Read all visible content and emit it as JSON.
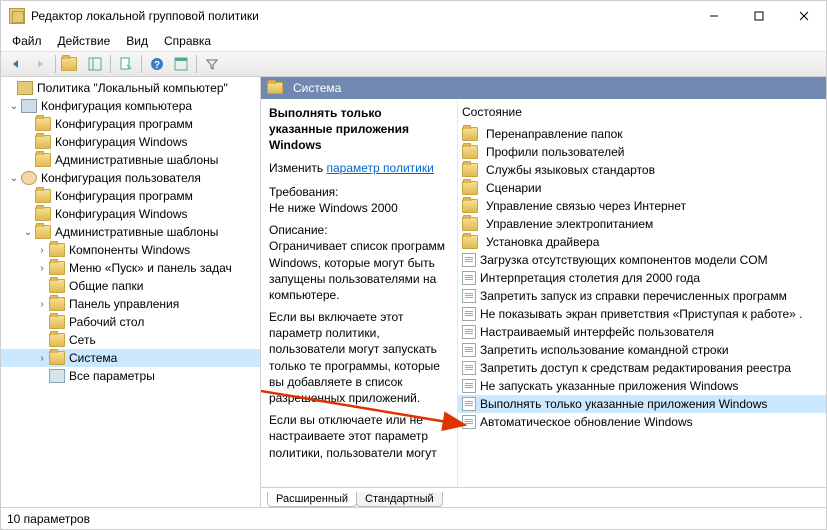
{
  "window": {
    "title": "Редактор локальной групповой политики"
  },
  "menubar": [
    "Файл",
    "Действие",
    "Вид",
    "Справка"
  ],
  "tree": {
    "root": "Политика \"Локальный компьютер\"",
    "computer": "Конфигурация компьютера",
    "computer_children": [
      "Конфигурация программ",
      "Конфигурация Windows",
      "Административные шаблоны"
    ],
    "user": "Конфигурация пользователя",
    "user_children": [
      "Конфигурация программ",
      "Конфигурация Windows"
    ],
    "admin_templates": "Административные шаблоны",
    "at_children": [
      "Компоненты Windows",
      "Меню «Пуск» и панель задач",
      "Общие папки",
      "Панель управления",
      "Рабочий стол",
      "Сеть",
      "Система"
    ],
    "all_params": "Все параметры"
  },
  "header": {
    "title": "Система"
  },
  "desc": {
    "title": "Выполнять только указанные приложения Windows",
    "edit_label": "Изменить",
    "link": "параметр политики",
    "req_label": "Требования:",
    "req_text": "Не ниже Windows 2000",
    "desc_label": "Описание:",
    "p1": "Ограничивает список программ Windows, которые могут быть запущены пользователями на компьютере.",
    "p2": "Если вы включаете этот параметр политики, пользователи могут запускать только те программы, которые вы добавляете в список разрешенных приложений.",
    "p3": "Если вы отключаете или не настраиваете этот параметр политики, пользователи могут"
  },
  "list": {
    "column_header": "Состояние",
    "folders": [
      "Перенаправление папок",
      "Профили пользователей",
      "Службы языковых стандартов",
      "Сценарии",
      "Управление связью через Интернет",
      "Управление электропитанием",
      "Установка драйвера"
    ],
    "settings": [
      "Загрузка отсутствующих компонентов модели COM",
      "Интерпретация столетия для 2000 года",
      "Запретить запуск из справки перечисленных программ",
      "Не показывать экран приветствия «Приступая к работе» .",
      "Настраиваемый интерфейс пользователя",
      "Запретить использование командной строки",
      "Запретить доступ к средствам редактирования реестра",
      "Не запускать указанные приложения Windows",
      "Выполнять только указанные приложения Windows",
      "Автоматическое обновление Windows"
    ],
    "selected_index": 8
  },
  "tabs": {
    "extended": "Расширенный",
    "standard": "Стандартный"
  },
  "status": "10 параметров"
}
